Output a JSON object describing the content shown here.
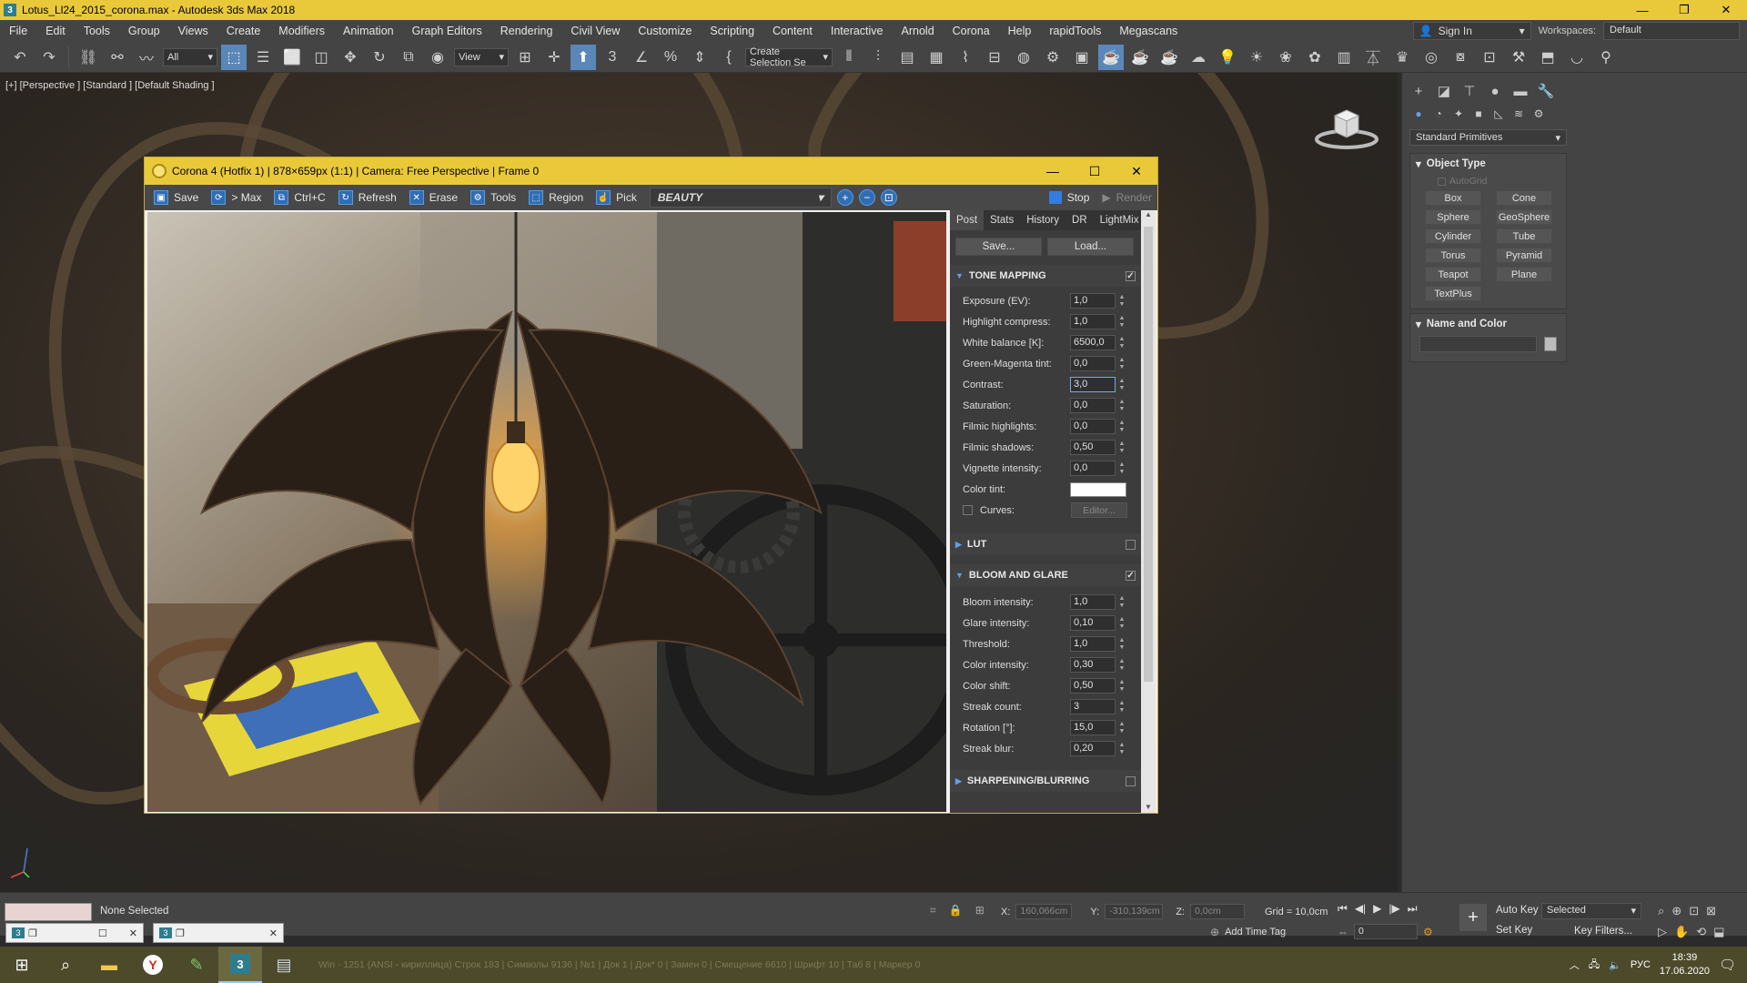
{
  "window": {
    "title": "Lotus_Ll24_2015_corona.max - Autodesk 3ds Max 2018",
    "app_icon": "3"
  },
  "menu": [
    "File",
    "Edit",
    "Tools",
    "Group",
    "Views",
    "Create",
    "Modifiers",
    "Animation",
    "Graph Editors",
    "Rendering",
    "Civil View",
    "Customize",
    "Scripting",
    "Content",
    "Interactive",
    "Arnold",
    "Corona",
    "Help",
    "rapidTools",
    "Megascans"
  ],
  "account": {
    "sign_in": "Sign In",
    "workspaces_label": "Workspaces:",
    "workspace": "Default"
  },
  "toolbar": {
    "selection_filter": "All",
    "ref_coord": "View",
    "named_selection": "Create Selection Se"
  },
  "viewport": {
    "label": "[+] [Perspective ] [Standard ] [Default Shading ]"
  },
  "command_panel": {
    "dropdown": "Standard Primitives",
    "object_type_title": "Object Type",
    "autogrid": "AutoGrid",
    "objects": [
      "Box",
      "Cone",
      "Sphere",
      "GeoSphere",
      "Cylinder",
      "Tube",
      "Torus",
      "Pyramid",
      "Teapot",
      "Plane",
      "TextPlus"
    ],
    "name_color_title": "Name and Color"
  },
  "vfb": {
    "title": "Corona 4 (Hotfix 1) | 878×659px (1:1) | Camera: Free Perspective | Frame 0",
    "toolbar": {
      "save": "Save",
      "tomax": "> Max",
      "copy": "Ctrl+C",
      "refresh": "Refresh",
      "erase": "Erase",
      "tools": "Tools",
      "region": "Region",
      "pick": "Pick",
      "pass": "BEAUTY",
      "stop": "Stop",
      "render": "Render"
    },
    "tabs": [
      "Post",
      "Stats",
      "History",
      "DR",
      "LightMix"
    ],
    "save_btn": "Save...",
    "load_btn": "Load...",
    "tone_mapping": {
      "title": "TONE MAPPING",
      "rows": [
        {
          "label": "Exposure (EV):",
          "value": "1,0"
        },
        {
          "label": "Highlight compress:",
          "value": "1,0"
        },
        {
          "label": "White balance [K]:",
          "value": "6500,0"
        },
        {
          "label": "Green-Magenta tint:",
          "value": "0,0"
        },
        {
          "label": "Contrast:",
          "value": "3,0"
        },
        {
          "label": "Saturation:",
          "value": "0,0"
        },
        {
          "label": "Filmic highlights:",
          "value": "0,0"
        },
        {
          "label": "Filmic shadows:",
          "value": "0,50"
        },
        {
          "label": "Vignette intensity:",
          "value": "0,0"
        }
      ],
      "color_tint_label": "Color tint:",
      "color_tint": "#ffffff",
      "curves_label": "Curves:",
      "editor_btn": "Editor..."
    },
    "lut": {
      "title": "LUT"
    },
    "bloom": {
      "title": "BLOOM AND GLARE",
      "rows": [
        {
          "label": "Bloom intensity:",
          "value": "1,0"
        },
        {
          "label": "Glare intensity:",
          "value": "0,10"
        },
        {
          "label": "Threshold:",
          "value": "1,0"
        },
        {
          "label": "Color intensity:",
          "value": "0,30"
        },
        {
          "label": "Color shift:",
          "value": "0,50"
        },
        {
          "label": "Streak count:",
          "value": "3"
        },
        {
          "label": "Rotation [°]:",
          "value": "15,0"
        },
        {
          "label": "Streak blur:",
          "value": "0,20"
        }
      ]
    },
    "sharpening": {
      "title": "SHARPENING/BLURRING"
    }
  },
  "status": {
    "selection": "None Selected",
    "x_label": "X:",
    "x_value": "160,066cm",
    "y_label": "Y:",
    "y_value": "-310,139cm",
    "z_label": "Z:",
    "z_value": "0,0cm",
    "grid": "Grid = 10,0cm",
    "add_time_tag": "Add Time Tag",
    "auto_key": "Auto Key",
    "set_key": "Set Key",
    "key_mode": "Selected",
    "key_filters": "Key Filters...",
    "frame": "0"
  },
  "taskbar": {
    "status_text": "Win · 1251 (ANSI - кириллица)          Строк 183 | Символы 9136 | №1 | Док 1 | Док* 0 | Замен 0 | Смещение 6610 | Шрифт 10 | Таб 8 | Маркер 0",
    "lang": "РУС",
    "time": "18:39",
    "date": "17.06.2020"
  }
}
